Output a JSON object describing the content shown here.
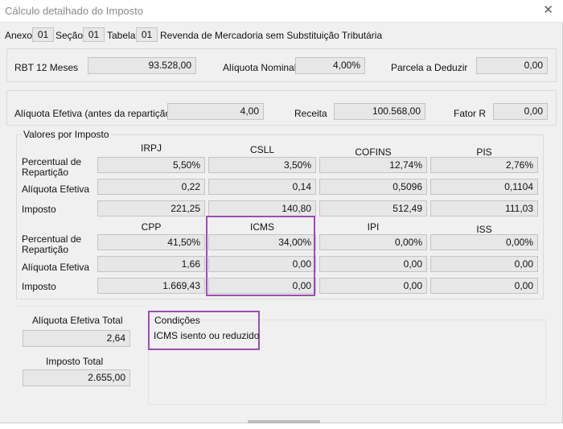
{
  "window": {
    "title": "Cálculo detalhado do Imposto",
    "close_glyph": "✕"
  },
  "header": {
    "anexo_label": "Anexo",
    "anexo_value": "01",
    "secao_label": "Seção",
    "secao_value": "01",
    "tabela_label": "Tabela",
    "tabela_value": "01",
    "description": "Revenda de Mercadoria sem Substituição Tributária"
  },
  "row1": {
    "rbt_label": "RBT 12 Meses",
    "rbt_value": "93.528,00",
    "aliquota_nominal_label": "Alíquota Nominal",
    "aliquota_nominal_value": "4,00%",
    "parcela_label": "Parcela a Deduzir",
    "parcela_value": "0,00"
  },
  "row2": {
    "aliquota_efetiva_label": "Alíquota Efetiva (antes da repartição)",
    "aliquota_efetiva_value": "4,00",
    "receita_label": "Receita",
    "receita_value": "100.568,00",
    "fator_label": "Fator R",
    "fator_value": "0,00"
  },
  "valores": {
    "title": "Valores por Imposto",
    "row_labels": {
      "percentual": "Percentual de Repartição",
      "aliquota": "Alíquota Efetiva",
      "imposto": "Imposto"
    },
    "top": {
      "headers": [
        "IRPJ",
        "CSLL",
        "COFINS",
        "PIS"
      ],
      "percentual": [
        "5,50%",
        "3,50%",
        "12,74%",
        "2,76%"
      ],
      "aliquota": [
        "0,22",
        "0,14",
        "0,5096",
        "0,1104"
      ],
      "imposto": [
        "221,25",
        "140,80",
        "512,49",
        "111,03"
      ]
    },
    "bottom": {
      "headers": [
        "CPP",
        "ICMS",
        "IPI",
        "ISS"
      ],
      "percentual": [
        "41,50%",
        "34,00%",
        "0,00%",
        "0,00%"
      ],
      "aliquota": [
        "1,66",
        "0,00",
        "0,00",
        "0,00"
      ],
      "imposto": [
        "1.669,43",
        "0,00",
        "0,00",
        "0,00"
      ]
    }
  },
  "totals": {
    "aliquota_total_label": "Alíquota Efetiva Total",
    "aliquota_total_value": "2,64",
    "imposto_total_label": "Imposto Total",
    "imposto_total_value": "2.655,00"
  },
  "condicoes": {
    "title": "Condições",
    "text": "ICMS isento ou reduzido"
  },
  "colors": {
    "highlight": "#9b4fb0",
    "field_bg": "#e7e7e7",
    "window_bg": "#f0f0f0"
  }
}
